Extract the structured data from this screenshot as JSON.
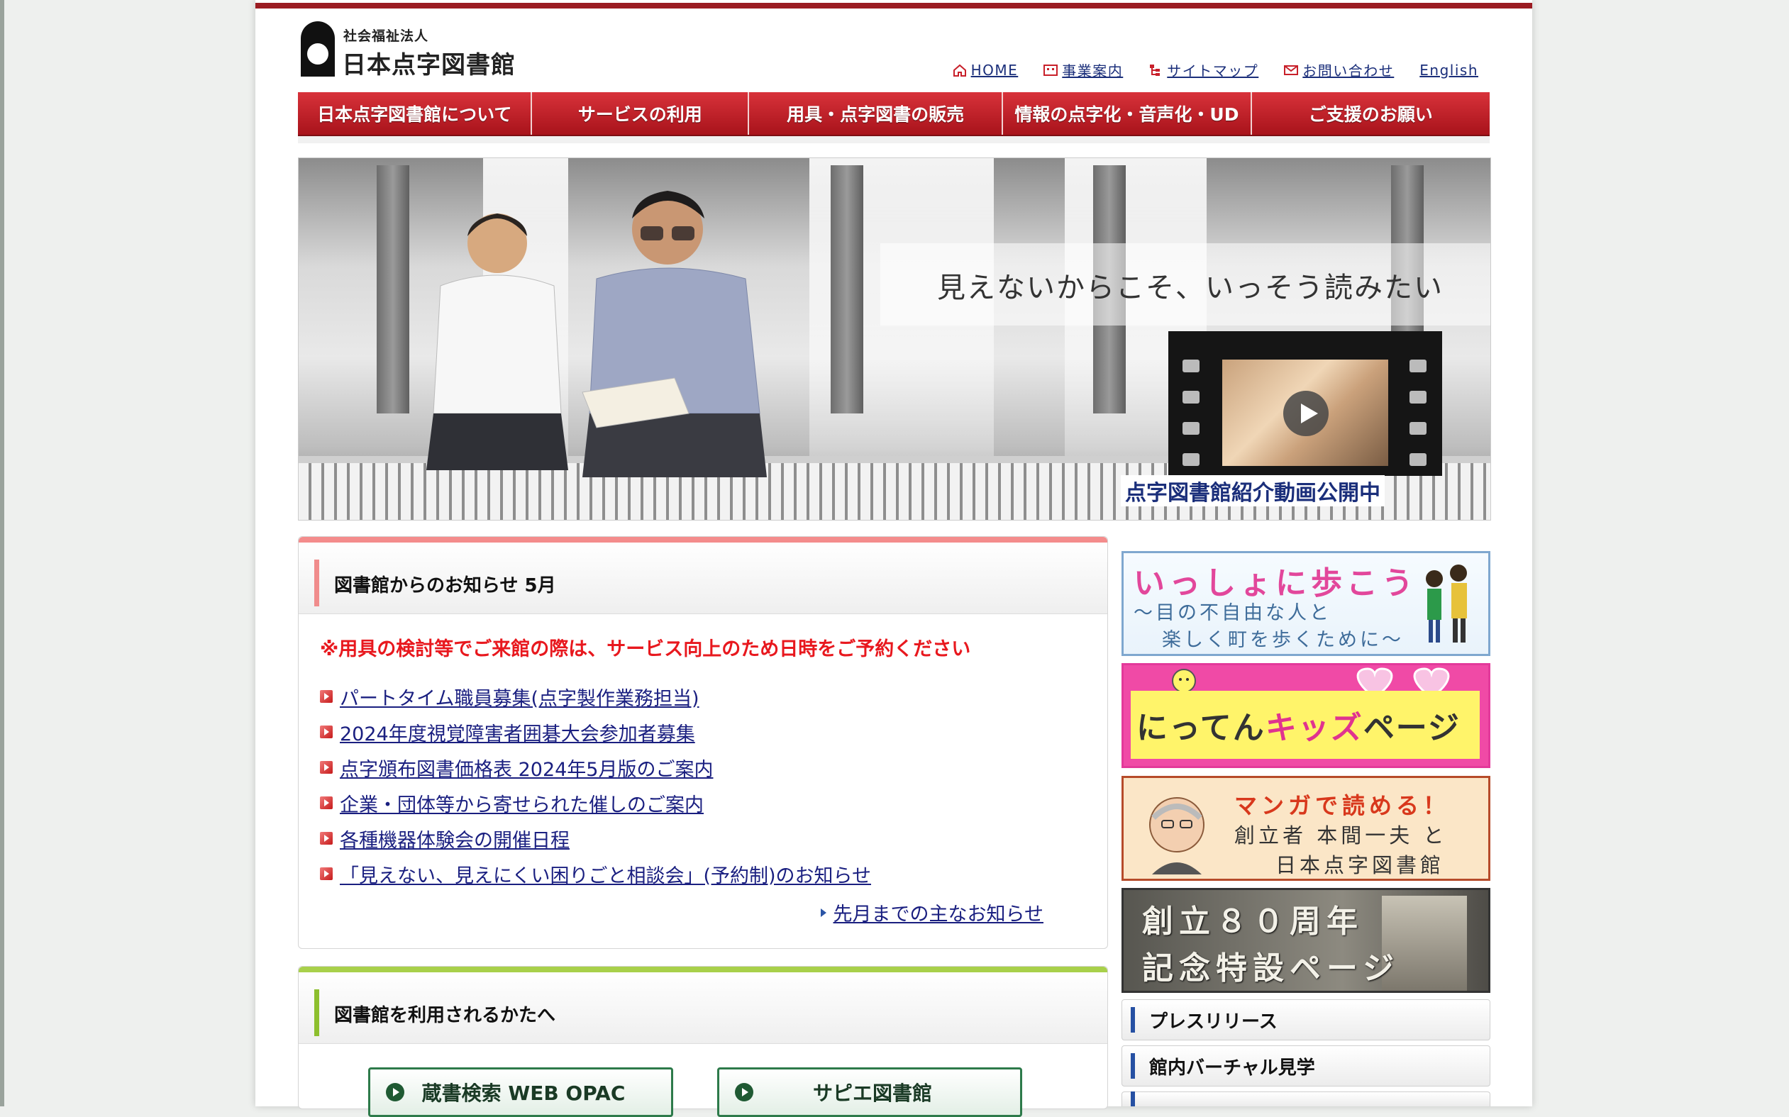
{
  "logo": {
    "sub": "社会福祉法人",
    "main": "日本点字図書館"
  },
  "util_nav": [
    {
      "label": "HOME",
      "icon": "home-icon"
    },
    {
      "label": "事業案内",
      "icon": "building-icon"
    },
    {
      "label": "サイトマップ",
      "icon": "sitemap-icon"
    },
    {
      "label": "お問い合わせ",
      "icon": "mail-icon"
    },
    {
      "label": "English",
      "icon": ""
    }
  ],
  "main_nav": [
    {
      "label": "日本点字図書館について"
    },
    {
      "label": "サービスの利用"
    },
    {
      "label": "用具・点字図書の販売"
    },
    {
      "label": "情報の点字化・音声化・UD"
    },
    {
      "label": "ご支援のお願い"
    }
  ],
  "hero": {
    "tagline": "見えないからこそ、いっそう読みたい",
    "video_caption": "点字図書館紹介動画公開中"
  },
  "news": {
    "title": "図書館からのお知らせ 5月",
    "notice": "※用具の検討等でご来館の際は、サービス向上のため日時をご予約ください",
    "items": [
      "パートタイム職員募集(点字製作業務担当)",
      "2024年度視覚障害者囲碁大会参加者募集",
      "点字頒布図書価格表 2024年5月版のご案内",
      "企業・団体等から寄せられた催しのご案内",
      "各種機器体験会の開催日程",
      "「見えない、見えにくい困りごと相談会」(予約制)のお知らせ"
    ],
    "more": "先月までの主なお知らせ"
  },
  "users": {
    "title": "図書館を利用されるかたへ",
    "buttons": [
      "蔵書検索 WEB OPAC",
      "サピエ図書館"
    ]
  },
  "banners": {
    "walk": {
      "line1": "いっしょに歩こう",
      "line2": "～目の不自由な人と",
      "line3": "楽しく町を歩くために～"
    },
    "kids": {
      "part1": "にってん",
      "part2": "キッズ",
      "part3": "ページ"
    },
    "manga": {
      "line1": "マンガで読める！",
      "line2": "創立者 本間一夫 と",
      "line3": "日本点字図書館"
    },
    "anniv": {
      "line1": "創立８０周年",
      "line2": "記念特設ページ"
    }
  },
  "side_links": [
    "プレスリリース",
    "館内バーチャル見学"
  ],
  "colors": {
    "brand_red": "#9b1c22",
    "nav_red": "#c61f27",
    "link": "#1a1f80",
    "notice_red": "#e8181e"
  }
}
